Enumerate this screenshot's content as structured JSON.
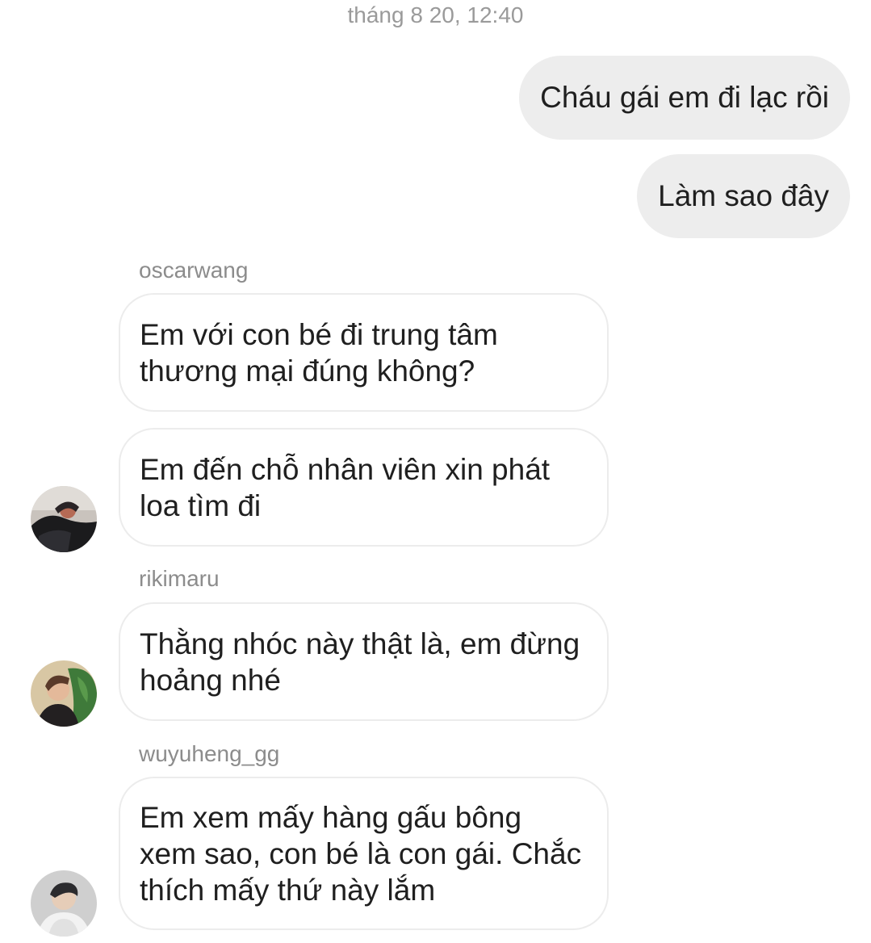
{
  "timestamp": "tháng 8 20, 12:40",
  "outgoing": [
    {
      "text": "Cháu gái em đi lạc rồi"
    },
    {
      "text": "Làm sao đây"
    }
  ],
  "senders": {
    "oscarwang": "oscarwang",
    "rikimaru": "rikimaru",
    "wuyuheng": "wuyuheng_gg"
  },
  "incoming": [
    {
      "sender": "oscarwang",
      "lines": [
        "Em với con bé đi trung tâm",
        "thương mại đúng không?"
      ]
    },
    {
      "sender": "oscarwang",
      "lines": [
        "Em đến chỗ nhân viên xin phát",
        "loa tìm đi"
      ]
    },
    {
      "sender": "rikimaru",
      "lines": [
        "Thằng nhóc này thật là, em đừng",
        "hoảng nhé"
      ]
    },
    {
      "sender": "wuyuheng_gg",
      "lines": [
        "Em xem mấy hàng gấu bông",
        "xem sao, con bé là con gái. Chắc",
        "thích mấy thứ này lắm"
      ]
    }
  ],
  "avatars": {
    "oscarwang": "avatar-oscarwang",
    "rikimaru": "avatar-rikimaru",
    "wuyuheng": "avatar-wuyuheng"
  },
  "colors": {
    "outgoing_bubble": "#ededed",
    "incoming_border": "#ececec",
    "meta_text": "#9a9a9a"
  }
}
